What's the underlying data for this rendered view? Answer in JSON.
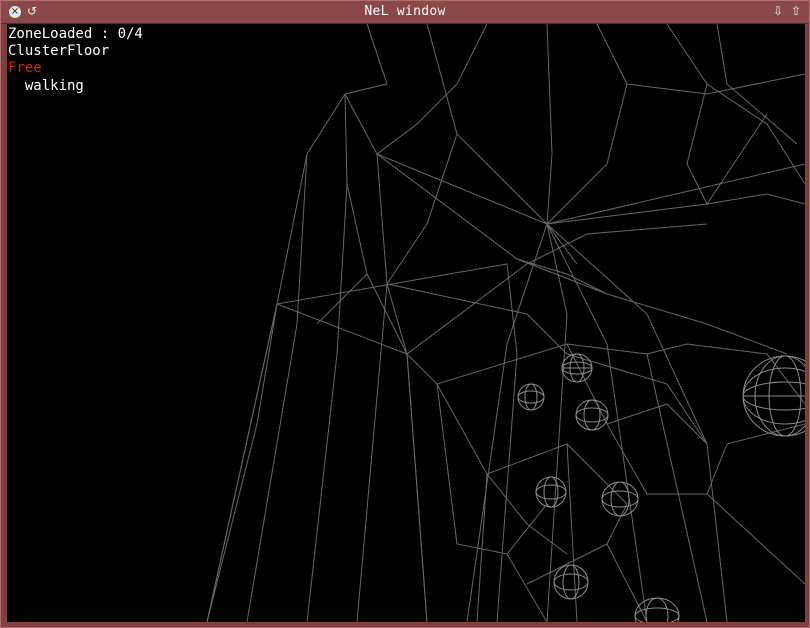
{
  "window": {
    "title": "NeL window",
    "close_glyph": "×",
    "menu_glyph": "↺",
    "minimize_glyph": "⇩",
    "maximize_glyph": "⇧"
  },
  "hud": {
    "line1": "ZoneLoaded : 0/4",
    "line2": "ClusterFloor",
    "line3": "Free",
    "line4": "  walking"
  },
  "colors": {
    "wire": "#7a7a7a",
    "sphere": "#8c8c8c",
    "accent_red": "#d02020",
    "frame": "#7d3f3f"
  }
}
